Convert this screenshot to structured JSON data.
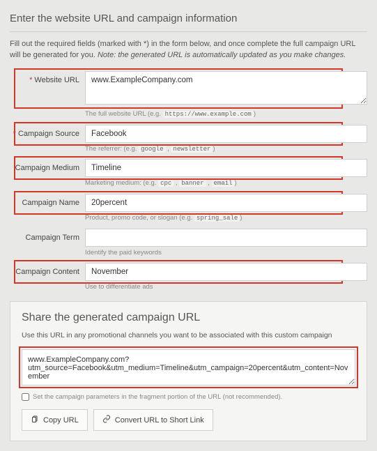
{
  "header": {
    "title": "Enter the website URL and campaign information",
    "intro_text": "Fill out the required fields (marked with *) in the form below, and once complete the full campaign URL will be generated for you. ",
    "intro_note": "Note: the generated URL is automatically updated as you make changes."
  },
  "fields": {
    "website_url": {
      "label": "Website URL",
      "required": true,
      "value": "www.ExampleCompany.com",
      "hint_pre": "The full website URL (e.g. ",
      "hint_code1": "https://www.example.com",
      "hint_post": ")"
    },
    "campaign_source": {
      "label": "Campaign Source",
      "required": true,
      "value": "Facebook",
      "hint_pre": "The referrer: (e.g. ",
      "hint_code1": "google",
      "hint_sep": " , ",
      "hint_code2": "newsletter",
      "hint_post": ")"
    },
    "campaign_medium": {
      "label": "Campaign Medium",
      "required": false,
      "value": "Timeline",
      "hint_pre": "Marketing medium: (e.g. ",
      "hint_code1": "cpc",
      "hint_sep1": " , ",
      "hint_code2": "banner",
      "hint_sep2": " , ",
      "hint_code3": "email",
      "hint_post": ")"
    },
    "campaign_name": {
      "label": "Campaign Name",
      "required": false,
      "value": "20percent",
      "hint_pre": "Product, promo code, or slogan (e.g. ",
      "hint_code1": "spring_sale",
      "hint_post": ")"
    },
    "campaign_term": {
      "label": "Campaign Term",
      "required": false,
      "value": "",
      "hint_pre": "Identify the paid keywords"
    },
    "campaign_content": {
      "label": "Campaign Content",
      "required": false,
      "value": "November",
      "hint_pre": "Use to differentiate ads"
    }
  },
  "share": {
    "title": "Share the generated campaign URL",
    "intro": "Use this URL in any promotional channels you want to be associated with this custom campaign",
    "generated_url": "www.ExampleCompany.com?utm_source=Facebook&utm_medium=Timeline&utm_campaign=20percent&utm_content=November",
    "fragment_label": "Set the campaign parameters in the fragment portion of the URL (not recommended).",
    "copy_label": "Copy URL",
    "convert_label": "Convert URL to Short Link"
  }
}
